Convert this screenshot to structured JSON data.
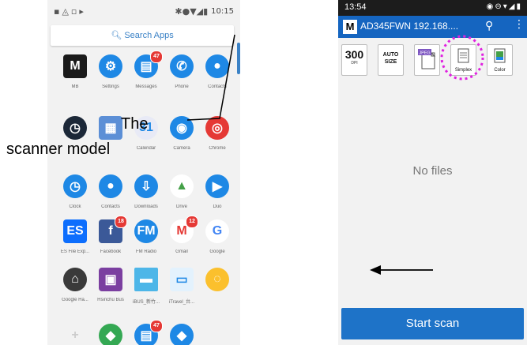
{
  "left_phone": {
    "status_bar": {
      "time": "10:15"
    },
    "search": {
      "placeholder": "Search Apps"
    },
    "apps": [
      {
        "label": "MB",
        "icon": "m-logo-icon",
        "badge": ""
      },
      {
        "label": "Settings",
        "icon": "gear-icon",
        "badge": ""
      },
      {
        "label": "Messages",
        "icon": "message-icon",
        "badge": "47"
      },
      {
        "label": "Phone",
        "icon": "phone-icon",
        "badge": ""
      },
      {
        "label": "Contacts",
        "icon": "contact-icon",
        "badge": ""
      },
      {
        "label": "",
        "icon": "clock-face-icon",
        "badge": ""
      },
      {
        "label": "",
        "icon": "puzzle-icon",
        "badge": ""
      },
      {
        "label": "Calendar",
        "icon": "calendar-icon",
        "badge": ""
      },
      {
        "label": "Camera",
        "icon": "camera-icon",
        "badge": ""
      },
      {
        "label": "Chrome",
        "icon": "chrome-icon",
        "badge": ""
      },
      {
        "label": "Clock",
        "icon": "clock-icon",
        "badge": ""
      },
      {
        "label": "Contacts",
        "icon": "contact-icon",
        "badge": ""
      },
      {
        "label": "Downloads",
        "icon": "download-icon",
        "badge": ""
      },
      {
        "label": "Drive",
        "icon": "drive-icon",
        "badge": ""
      },
      {
        "label": "Duo",
        "icon": "video-icon",
        "badge": ""
      },
      {
        "label": "ES File Exp...",
        "icon": "folder-icon",
        "badge": ""
      },
      {
        "label": "Facebook",
        "icon": "facebook-icon",
        "badge": "18"
      },
      {
        "label": "FM Radio",
        "icon": "radio-icon",
        "badge": ""
      },
      {
        "label": "Gmail",
        "icon": "mail-icon",
        "badge": "12"
      },
      {
        "label": "Google",
        "icon": "google-icon",
        "badge": ""
      },
      {
        "label": "Google Ha...",
        "icon": "home-icon",
        "badge": ""
      },
      {
        "label": "Hsinchu Bus",
        "icon": "bus-icon",
        "badge": ""
      },
      {
        "label": "iBUS_新竹...",
        "icon": "bus-city-icon",
        "badge": ""
      },
      {
        "label": "iTravel_台...",
        "icon": "travel-icon",
        "badge": ""
      },
      {
        "label": "",
        "icon": "bulb-icon",
        "badge": ""
      },
      {
        "label": "",
        "icon": "plus-icon",
        "badge": ""
      },
      {
        "label": "",
        "icon": "maps-icon",
        "badge": ""
      },
      {
        "label": "",
        "icon": "message-icon",
        "badge": "47"
      },
      {
        "label": "",
        "icon": "messenger-icon",
        "badge": ""
      }
    ]
  },
  "annotation": {
    "line1": "The",
    "line2": "scanner model"
  },
  "right_phone": {
    "status_bar": {
      "time": "13:54"
    },
    "app_bar": {
      "logo": "M",
      "title": "AD345FWN 192.168...."
    },
    "toolbar": {
      "dpi_value": "300",
      "dpi_unit": "DPI",
      "auto_size": "AUTO SIZE",
      "format": "JPEG",
      "simplex": "Simplex",
      "color": "Color"
    },
    "empty_text": "No files",
    "scan_button": "Start scan"
  },
  "colors": {
    "appbar": "#1565c0",
    "scan_button": "#1e73c8",
    "highlight_circle": "#e020e0"
  }
}
